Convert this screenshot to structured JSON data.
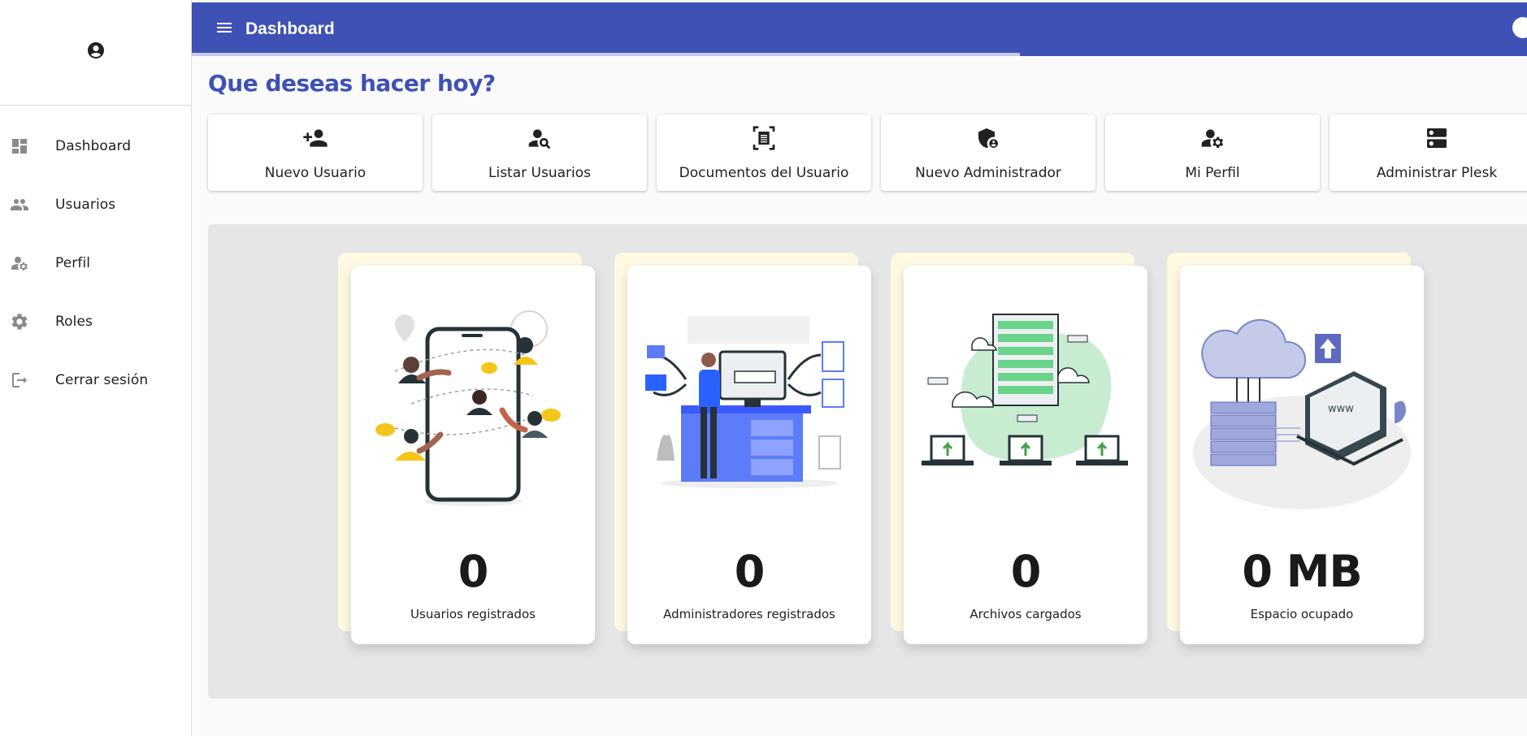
{
  "sidebar": {
    "avatar_icon": "account-circle-icon",
    "items": [
      {
        "label": "Dashboard",
        "icon": "dashboard-icon"
      },
      {
        "label": "Usuarios",
        "icon": "people-icon"
      },
      {
        "label": "Perfil",
        "icon": "manage-account-icon"
      },
      {
        "label": "Roles",
        "icon": "gear-icon"
      },
      {
        "label": "Cerrar sesión",
        "icon": "logout-icon"
      }
    ]
  },
  "header": {
    "title": "Dashboard",
    "accent_color": "#3f51b5",
    "loading_progress": 0.62
  },
  "main": {
    "heading": "Que deseas hacer hoy?",
    "actions": [
      {
        "label": "Nuevo Usuario",
        "icon": "person-add-icon"
      },
      {
        "label": "Listar Usuarios",
        "icon": "person-search-icon"
      },
      {
        "label": "Documentos del Usuario",
        "icon": "document-scan-icon"
      },
      {
        "label": "Nuevo Administrador",
        "icon": "admin-shield-icon"
      },
      {
        "label": "Mi Perfil",
        "icon": "person-gear-icon"
      },
      {
        "label": "Administrar Plesk",
        "icon": "server-icon"
      }
    ],
    "stats": [
      {
        "value": "0",
        "caption": "Usuarios registrados",
        "illustration": "social-network-phone-illustration"
      },
      {
        "value": "0",
        "caption": "Administradores registrados",
        "illustration": "data-extraction-illustration"
      },
      {
        "value": "0",
        "caption": "Archivos cargados",
        "illustration": "server-upload-illustration"
      },
      {
        "value": "0 MB",
        "caption": "Espacio ocupado",
        "illustration": "cloud-storage-illustration"
      }
    ]
  }
}
